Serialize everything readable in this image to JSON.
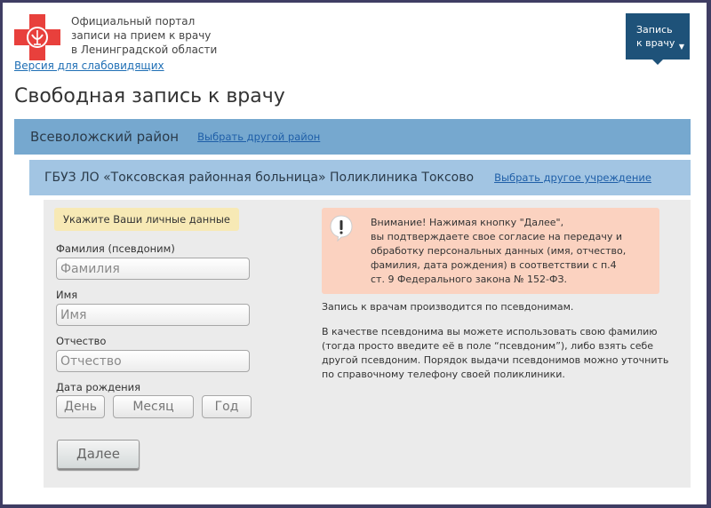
{
  "header": {
    "portal_title_lines": [
      "Официальный портал",
      "записи на прием к врачу",
      "в Ленинградской области"
    ],
    "low_vision_link": "Версия для слабовидящих",
    "appointment_button": {
      "line1": "Запись",
      "line2": "к врачу",
      "arrow": "▼"
    }
  },
  "page_title": "Свободная запись к врачу",
  "district": {
    "name": "Всеволожский район",
    "change_link": "Выбрать другой район"
  },
  "clinic": {
    "name": "ГБУЗ ЛО «Токсовская районная больница» Поликлиника Токсово",
    "change_link": "Выбрать другое учреждение"
  },
  "form": {
    "hint": "Укажите Ваши личные данные",
    "fields": [
      {
        "label": "Фамилия (псевдоним)",
        "placeholder": "Фамилия",
        "value": ""
      },
      {
        "label": "Имя",
        "placeholder": "Имя",
        "value": ""
      },
      {
        "label": "Отчество",
        "placeholder": "Отчество",
        "value": ""
      }
    ],
    "birth_date": {
      "label": "Дата рождения",
      "day": "День",
      "month": "Месяц",
      "year": "Год"
    },
    "next_button": "Далее"
  },
  "warning": {
    "icon": "exclamation-bubble-icon",
    "lines": [
      "Внимание! Нажимая кнопку \"Далее\",",
      "вы подтверждаете свое согласие на передачу и",
      "обработку персональных данных (имя, отчество,",
      "фамилия, дата рождения) в соответствии с п.4",
      "ст. 9 Федерального закона № 152-ФЗ."
    ]
  },
  "info": {
    "paragraph1": "Запись к врачам производится по псевдонимам.",
    "paragraph2_lines": [
      "В качестве псевдонима вы можете использовать свою фамилию",
      "(тогда просто введите её в поле “псевдоним”), либо взять себе",
      "другой псевдоним. Порядок выдачи псевдонимов можно уточнить",
      "по справочному телефону своей поликлиники."
    ]
  },
  "colors": {
    "logo_red": "#e8403c",
    "appointment_button": "#1e5279",
    "district_bar": "#76a8cf",
    "clinic_bar": "#a2c5e3",
    "hint_bg": "#f7e9b5",
    "warning_bg": "#fbd2c0",
    "link": "#1f5fa8"
  }
}
